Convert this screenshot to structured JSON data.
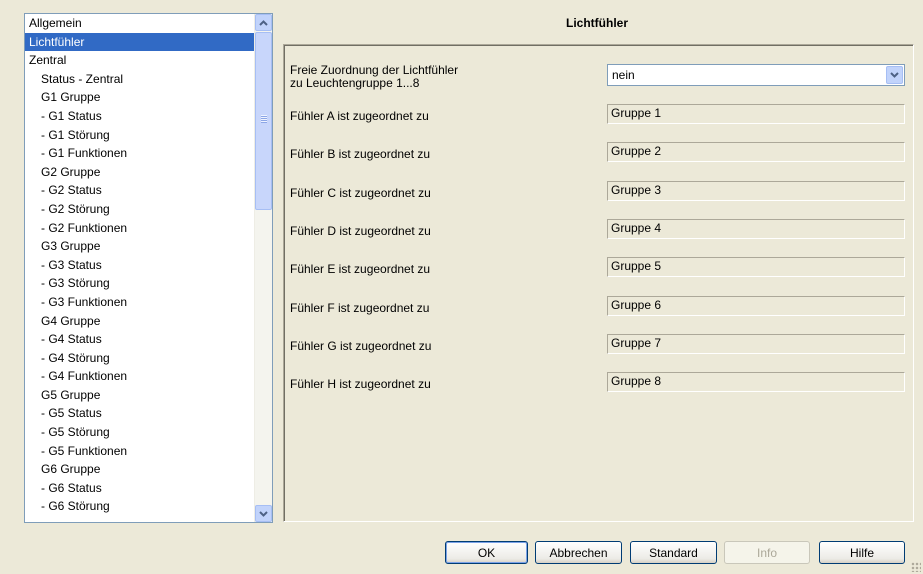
{
  "tree": {
    "items": [
      {
        "label": "Allgemein",
        "level": 0,
        "selected": false
      },
      {
        "label": "Lichtfühler",
        "level": 0,
        "selected": true
      },
      {
        "label": "Zentral",
        "level": 0,
        "selected": false
      },
      {
        "label": "Status - Zentral",
        "level": 1,
        "selected": false
      },
      {
        "label": "G1 Gruppe",
        "level": 1,
        "selected": false
      },
      {
        "label": "- G1 Status",
        "level": 1,
        "selected": false
      },
      {
        "label": "- G1 Störung",
        "level": 1,
        "selected": false
      },
      {
        "label": "- G1 Funktionen",
        "level": 1,
        "selected": false
      },
      {
        "label": "G2 Gruppe",
        "level": 1,
        "selected": false
      },
      {
        "label": "- G2 Status",
        "level": 1,
        "selected": false
      },
      {
        "label": "- G2 Störung",
        "level": 1,
        "selected": false
      },
      {
        "label": "- G2 Funktionen",
        "level": 1,
        "selected": false
      },
      {
        "label": "G3 Gruppe",
        "level": 1,
        "selected": false
      },
      {
        "label": "- G3 Status",
        "level": 1,
        "selected": false
      },
      {
        "label": "- G3 Störung",
        "level": 1,
        "selected": false
      },
      {
        "label": "- G3 Funktionen",
        "level": 1,
        "selected": false
      },
      {
        "label": "G4 Gruppe",
        "level": 1,
        "selected": false
      },
      {
        "label": "- G4 Status",
        "level": 1,
        "selected": false
      },
      {
        "label": "- G4 Störung",
        "level": 1,
        "selected": false
      },
      {
        "label": "- G4 Funktionen",
        "level": 1,
        "selected": false
      },
      {
        "label": "G5 Gruppe",
        "level": 1,
        "selected": false
      },
      {
        "label": "- G5 Status",
        "level": 1,
        "selected": false
      },
      {
        "label": "- G5 Störung",
        "level": 1,
        "selected": false
      },
      {
        "label": "- G5 Funktionen",
        "level": 1,
        "selected": false
      },
      {
        "label": "G6 Gruppe",
        "level": 1,
        "selected": false
      },
      {
        "label": "- G6 Status",
        "level": 1,
        "selected": false
      },
      {
        "label": "- G6 Störung",
        "level": 1,
        "selected": false
      }
    ]
  },
  "panel": {
    "title": "Lichtfühler",
    "assignment_label_line1": "Freie Zuordnung der Lichtfühler",
    "assignment_label_line2": "zu Leuchtengruppe 1...8",
    "assignment_value": "nein",
    "sensors": [
      {
        "label": "Fühler A ist zugeordnet zu",
        "value": "Gruppe 1"
      },
      {
        "label": "Fühler B ist zugeordnet zu",
        "value": "Gruppe 2"
      },
      {
        "label": "Fühler C ist zugeordnet zu",
        "value": "Gruppe 3"
      },
      {
        "label": "Fühler D ist zugeordnet zu",
        "value": "Gruppe 4"
      },
      {
        "label": "Fühler E ist zugeordnet zu",
        "value": "Gruppe 5"
      },
      {
        "label": "Fühler F ist zugeordnet zu",
        "value": "Gruppe 6"
      },
      {
        "label": "Fühler G ist zugeordnet zu",
        "value": "Gruppe 7"
      },
      {
        "label": "Fühler H ist zugeordnet zu",
        "value": "Gruppe 8"
      }
    ]
  },
  "buttons": {
    "ok": "OK",
    "cancel": "Abbrechen",
    "standard": "Standard",
    "info": "Info",
    "help": "Hilfe"
  },
  "icons": {
    "scroll_up": "chevron-up-icon",
    "scroll_down": "chevron-down-icon",
    "combo": "chevron-down-icon"
  },
  "colors": {
    "selection": "#316ac5",
    "dialog_bg": "#ece9d8",
    "scroll_accent": "#4d6185"
  }
}
